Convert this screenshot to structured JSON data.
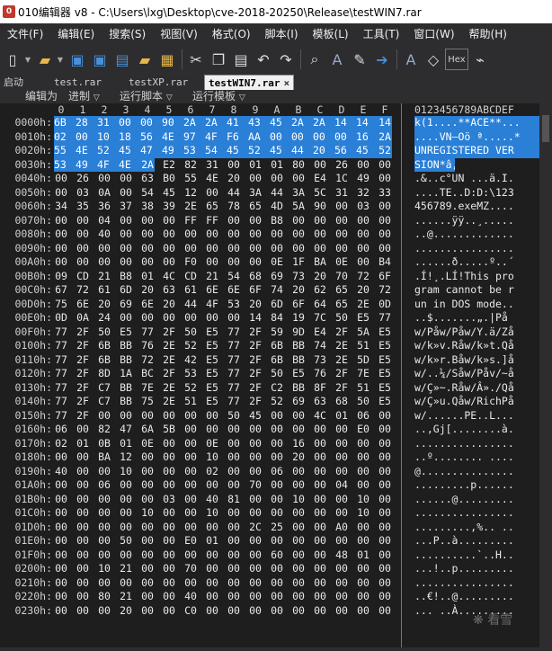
{
  "window": {
    "title": "010编辑器 v8 - C:\\Users\\lxg\\Desktop\\cve-2018-20250\\Release\\testWIN7.rar"
  },
  "menu": [
    {
      "label": "文件(F)"
    },
    {
      "label": "编辑(E)"
    },
    {
      "label": "搜索(S)"
    },
    {
      "label": "视图(V)"
    },
    {
      "label": "格式(O)"
    },
    {
      "label": "脚本(I)"
    },
    {
      "label": "模板(L)"
    },
    {
      "label": "工具(T)"
    },
    {
      "label": "窗口(W)"
    },
    {
      "label": "帮助(H)"
    }
  ],
  "toolbar": {
    "icons": [
      "new-file-icon",
      "open-folder-icon",
      "save-icon",
      "save-as-icon",
      "save-all-icon",
      "open-folder-2-icon",
      "workspace-icon",
      "cut-icon",
      "copy-icon",
      "paste-icon",
      "undo-icon",
      "redo-icon",
      "find-icon",
      "find-replace-icon",
      "find-in-files-icon",
      "goto-icon",
      "text-format-icon",
      "highlight-icon",
      "hex-toggle-icon",
      "more-icon"
    ],
    "hex_label": "Hex"
  },
  "tabs": [
    {
      "label": "启动"
    },
    {
      "label": "test.rar"
    },
    {
      "label": "testXP.rar"
    },
    {
      "label": "testWIN7.rar"
    }
  ],
  "tab_close_glyph": "×",
  "editor_bar": {
    "edit_as_label": "编辑为",
    "edit_as_value": "进制",
    "run_script": "运行脚本",
    "run_template": "运行模板"
  },
  "hex_header": {
    "columns": [
      "0",
      "1",
      "2",
      "3",
      "4",
      "5",
      "6",
      "7",
      "8",
      "9",
      "A",
      "B",
      "C",
      "D",
      "E",
      "F"
    ],
    "ascii_header": "0123456789ABCDEF"
  },
  "rows": [
    {
      "offset": "0000h:",
      "bytes": [
        "6B",
        "28",
        "31",
        "00",
        "00",
        "90",
        "2A",
        "2A",
        "41",
        "43",
        "45",
        "2A",
        "2A",
        "14",
        "14",
        "14"
      ],
      "ascii": "k(1....**ACE**..."
    },
    {
      "offset": "0010h:",
      "bytes": [
        "02",
        "00",
        "10",
        "18",
        "56",
        "4E",
        "97",
        "4F",
        "F6",
        "AA",
        "00",
        "00",
        "00",
        "00",
        "16",
        "2A"
      ],
      "ascii": "....VN—Oö ª.....*"
    },
    {
      "offset": "0020h:",
      "bytes": [
        "55",
        "4E",
        "52",
        "45",
        "47",
        "49",
        "53",
        "54",
        "45",
        "52",
        "45",
        "44",
        "20",
        "56",
        "45",
        "52"
      ],
      "ascii": "UNREGISTERED VER"
    },
    {
      "offset": "0030h:",
      "bytes": [
        "53",
        "49",
        "4F",
        "4E",
        "2A",
        "E2",
        "82",
        "31",
        "00",
        "01",
        "01",
        "80",
        "00",
        "26",
        "00",
        "00"
      ],
      "ascii": "SION*â‚1...€.&.."
    },
    {
      "offset": "0040h:",
      "bytes": [
        "00",
        "26",
        "00",
        "00",
        "63",
        "B0",
        "55",
        "4E",
        "20",
        "00",
        "00",
        "00",
        "E4",
        "1C",
        "49",
        "00"
      ],
      "ascii": ".&..c°UN ...ä.I."
    },
    {
      "offset": "0050h:",
      "bytes": [
        "00",
        "03",
        "0A",
        "00",
        "54",
        "45",
        "12",
        "00",
        "44",
        "3A",
        "44",
        "3A",
        "5C",
        "31",
        "32",
        "33"
      ],
      "ascii": "....TE..D:D:\\123"
    },
    {
      "offset": "0060h:",
      "bytes": [
        "34",
        "35",
        "36",
        "37",
        "38",
        "39",
        "2E",
        "65",
        "78",
        "65",
        "4D",
        "5A",
        "90",
        "00",
        "03",
        "00"
      ],
      "ascii": "456789.exeMZ...."
    },
    {
      "offset": "0070h:",
      "bytes": [
        "00",
        "00",
        "04",
        "00",
        "00",
        "00",
        "FF",
        "FF",
        "00",
        "00",
        "B8",
        "00",
        "00",
        "00",
        "00",
        "00"
      ],
      "ascii": "......ÿÿ..¸....."
    },
    {
      "offset": "0080h:",
      "bytes": [
        "00",
        "00",
        "40",
        "00",
        "00",
        "00",
        "00",
        "00",
        "00",
        "00",
        "00",
        "00",
        "00",
        "00",
        "00",
        "00"
      ],
      "ascii": "..@............."
    },
    {
      "offset": "0090h:",
      "bytes": [
        "00",
        "00",
        "00",
        "00",
        "00",
        "00",
        "00",
        "00",
        "00",
        "00",
        "00",
        "00",
        "00",
        "00",
        "00",
        "00"
      ],
      "ascii": "................"
    },
    {
      "offset": "00A0h:",
      "bytes": [
        "00",
        "00",
        "00",
        "00",
        "00",
        "00",
        "F0",
        "00",
        "00",
        "00",
        "0E",
        "1F",
        "BA",
        "0E",
        "00",
        "B4"
      ],
      "ascii": "......ð.....º..´"
    },
    {
      "offset": "00B0h:",
      "bytes": [
        "09",
        "CD",
        "21",
        "B8",
        "01",
        "4C",
        "CD",
        "21",
        "54",
        "68",
        "69",
        "73",
        "20",
        "70",
        "72",
        "6F"
      ],
      "ascii": ".Í!¸.LÍ!This pro"
    },
    {
      "offset": "00C0h:",
      "bytes": [
        "67",
        "72",
        "61",
        "6D",
        "20",
        "63",
        "61",
        "6E",
        "6E",
        "6F",
        "74",
        "20",
        "62",
        "65",
        "20",
        "72"
      ],
      "ascii": "gram cannot be r"
    },
    {
      "offset": "00D0h:",
      "bytes": [
        "75",
        "6E",
        "20",
        "69",
        "6E",
        "20",
        "44",
        "4F",
        "53",
        "20",
        "6D",
        "6F",
        "64",
        "65",
        "2E",
        "0D"
      ],
      "ascii": "un in DOS mode.."
    },
    {
      "offset": "00E0h:",
      "bytes": [
        "0D",
        "0A",
        "24",
        "00",
        "00",
        "00",
        "00",
        "00",
        "00",
        "14",
        "84",
        "19",
        "7C",
        "50",
        "E5",
        "77"
      ],
      "ascii": "..$.......„.|På"
    },
    {
      "offset": "00F0h:",
      "bytes": [
        "77",
        "2F",
        "50",
        "E5",
        "77",
        "2F",
        "50",
        "E5",
        "77",
        "2F",
        "59",
        "9D",
        "E4",
        "2F",
        "5A",
        "E5"
      ],
      "ascii": "w/Påw/Påw/Y.ä/Zå"
    },
    {
      "offset": "0100h:",
      "bytes": [
        "77",
        "2F",
        "6B",
        "BB",
        "76",
        "2E",
        "52",
        "E5",
        "77",
        "2F",
        "6B",
        "BB",
        "74",
        "2E",
        "51",
        "E5"
      ],
      "ascii": "w/k»v.Råw/k»t.Qå"
    },
    {
      "offset": "0110h:",
      "bytes": [
        "77",
        "2F",
        "6B",
        "BB",
        "72",
        "2E",
        "42",
        "E5",
        "77",
        "2F",
        "6B",
        "BB",
        "73",
        "2E",
        "5D",
        "E5"
      ],
      "ascii": "w/k»r.Båw/k»s.]å"
    },
    {
      "offset": "0120h:",
      "bytes": [
        "77",
        "2F",
        "8D",
        "1A",
        "BC",
        "2F",
        "53",
        "E5",
        "77",
        "2F",
        "50",
        "E5",
        "76",
        "2F",
        "7E",
        "E5"
      ],
      "ascii": "w/..¼/Såw/Påv/~å"
    },
    {
      "offset": "0130h:",
      "bytes": [
        "77",
        "2F",
        "C7",
        "BB",
        "7E",
        "2E",
        "52",
        "E5",
        "77",
        "2F",
        "C2",
        "BB",
        "8F",
        "2F",
        "51",
        "E5"
      ],
      "ascii": "w/Ç»~.Råw/Â»./Qå"
    },
    {
      "offset": "0140h:",
      "bytes": [
        "77",
        "2F",
        "C7",
        "BB",
        "75",
        "2E",
        "51",
        "E5",
        "77",
        "2F",
        "52",
        "69",
        "63",
        "68",
        "50",
        "E5"
      ],
      "ascii": "w/Ç»u.Qåw/RichPå"
    },
    {
      "offset": "0150h:",
      "bytes": [
        "77",
        "2F",
        "00",
        "00",
        "00",
        "00",
        "00",
        "00",
        "50",
        "45",
        "00",
        "00",
        "4C",
        "01",
        "06",
        "00"
      ],
      "ascii": "w/......PE..L..."
    },
    {
      "offset": "0160h:",
      "bytes": [
        "06",
        "00",
        "82",
        "47",
        "6A",
        "5B",
        "00",
        "00",
        "00",
        "00",
        "00",
        "00",
        "00",
        "00",
        "E0",
        "00"
      ],
      "ascii": "..‚Gj[........à."
    },
    {
      "offset": "0170h:",
      "bytes": [
        "02",
        "01",
        "0B",
        "01",
        "0E",
        "00",
        "00",
        "0E",
        "00",
        "00",
        "00",
        "16",
        "00",
        "00",
        "00",
        "00"
      ],
      "ascii": "................"
    },
    {
      "offset": "0180h:",
      "bytes": [
        "00",
        "00",
        "BA",
        "12",
        "00",
        "00",
        "00",
        "10",
        "00",
        "00",
        "00",
        "20",
        "00",
        "00",
        "00",
        "00"
      ],
      "ascii": "..º........ ...."
    },
    {
      "offset": "0190h:",
      "bytes": [
        "40",
        "00",
        "00",
        "10",
        "00",
        "00",
        "00",
        "02",
        "00",
        "00",
        "06",
        "00",
        "00",
        "00",
        "00",
        "00"
      ],
      "ascii": "@..............."
    },
    {
      "offset": "01A0h:",
      "bytes": [
        "00",
        "00",
        "06",
        "00",
        "00",
        "00",
        "00",
        "00",
        "00",
        "70",
        "00",
        "00",
        "00",
        "04",
        "00",
        "00"
      ],
      "ascii": ".........p......"
    },
    {
      "offset": "01B0h:",
      "bytes": [
        "00",
        "00",
        "00",
        "00",
        "00",
        "03",
        "00",
        "40",
        "81",
        "00",
        "00",
        "10",
        "00",
        "00",
        "10",
        "00"
      ],
      "ascii": "......@........."
    },
    {
      "offset": "01C0h:",
      "bytes": [
        "00",
        "00",
        "00",
        "00",
        "10",
        "00",
        "00",
        "10",
        "00",
        "00",
        "00",
        "00",
        "00",
        "00",
        "10",
        "00"
      ],
      "ascii": "................"
    },
    {
      "offset": "01D0h:",
      "bytes": [
        "00",
        "00",
        "00",
        "00",
        "00",
        "00",
        "00",
        "00",
        "00",
        "2C",
        "25",
        "00",
        "00",
        "A0",
        "00",
        "00"
      ],
      "ascii": ".........,%.. .."
    },
    {
      "offset": "01E0h:",
      "bytes": [
        "00",
        "00",
        "00",
        "50",
        "00",
        "00",
        "E0",
        "01",
        "00",
        "00",
        "00",
        "00",
        "00",
        "00",
        "00",
        "00"
      ],
      "ascii": "...P..à........."
    },
    {
      "offset": "01F0h:",
      "bytes": [
        "00",
        "00",
        "00",
        "00",
        "00",
        "00",
        "00",
        "00",
        "00",
        "00",
        "60",
        "00",
        "00",
        "48",
        "01",
        "00"
      ],
      "ascii": "..........`..H.."
    },
    {
      "offset": "0200h:",
      "bytes": [
        "00",
        "00",
        "10",
        "21",
        "00",
        "00",
        "70",
        "00",
        "00",
        "00",
        "00",
        "00",
        "00",
        "00",
        "00",
        "00"
      ],
      "ascii": "...!..p........."
    },
    {
      "offset": "0210h:",
      "bytes": [
        "00",
        "00",
        "00",
        "00",
        "00",
        "00",
        "00",
        "00",
        "00",
        "00",
        "00",
        "00",
        "00",
        "00",
        "00",
        "00"
      ],
      "ascii": "................"
    },
    {
      "offset": "0220h:",
      "bytes": [
        "00",
        "00",
        "80",
        "21",
        "00",
        "00",
        "40",
        "00",
        "00",
        "00",
        "00",
        "00",
        "00",
        "00",
        "00",
        "00"
      ],
      "ascii": "..€!..@........."
    },
    {
      "offset": "0230h:",
      "bytes": [
        "00",
        "00",
        "00",
        "20",
        "00",
        "00",
        "C0",
        "00",
        "00",
        "00",
        "00",
        "00",
        "00",
        "00",
        "00",
        "00"
      ],
      "ascii": "... ..À........."
    }
  ],
  "watermark": "看雪",
  "colors": {
    "selection": "#2a7fd6",
    "background": "#1e1e1e",
    "chrome": "#2d2d30"
  }
}
